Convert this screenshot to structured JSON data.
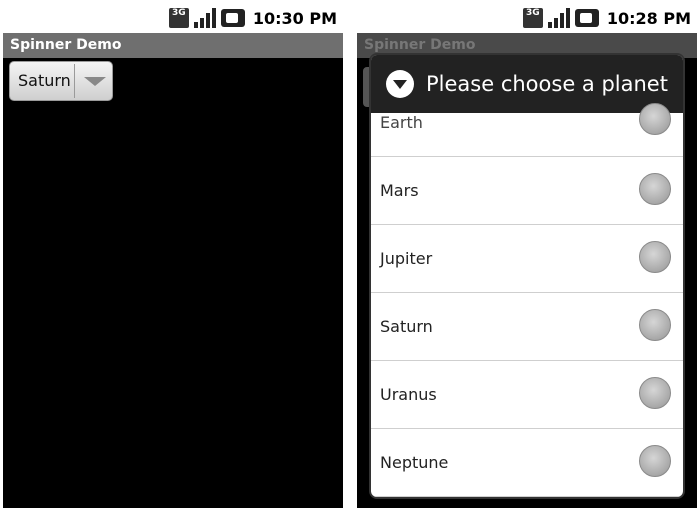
{
  "left_screen": {
    "status": {
      "clock": "10:30 PM",
      "network": "3G"
    },
    "title": "Spinner Demo",
    "spinner": {
      "selected": "Saturn"
    }
  },
  "right_screen": {
    "status": {
      "clock": "10:28 PM",
      "network": "3G"
    },
    "background_title": "Spinner Demo",
    "dialog": {
      "title": "Please choose a planet",
      "items": [
        "Earth",
        "Mars",
        "Jupiter",
        "Saturn",
        "Uranus",
        "Neptune"
      ]
    }
  },
  "colors": {
    "title_bar": "#6f6f6f",
    "dialog_header": "#222222",
    "radio": "#a8a8a8"
  }
}
